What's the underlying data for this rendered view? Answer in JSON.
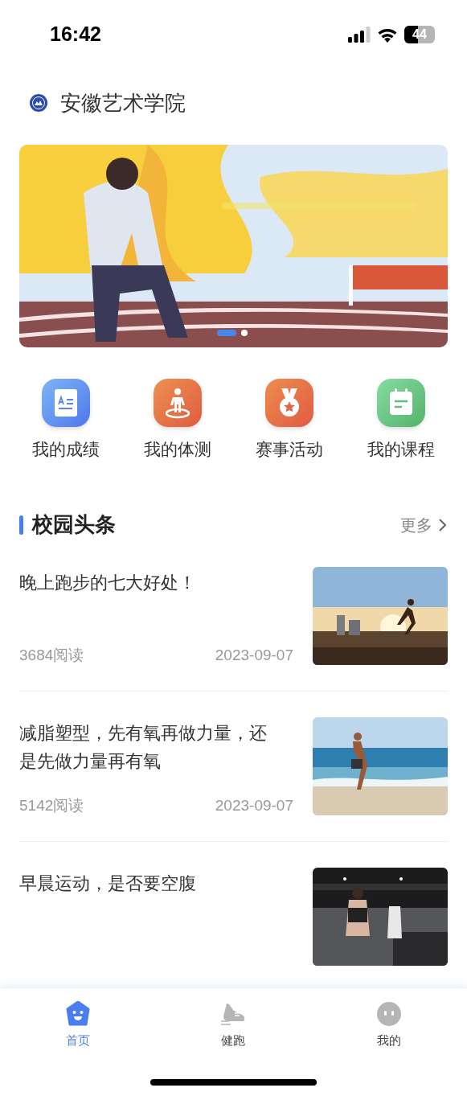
{
  "status_bar": {
    "time": "16:42",
    "battery": "44"
  },
  "header": {
    "title": "安徽艺术学院"
  },
  "banner": {
    "dots": [
      {
        "selected": true
      },
      {
        "selected": false
      }
    ]
  },
  "shortcuts": [
    {
      "label": "我的成绩",
      "kind": "grades"
    },
    {
      "label": "我的体测",
      "kind": "fitness"
    },
    {
      "label": "赛事活动",
      "kind": "events"
    },
    {
      "label": "我的课程",
      "kind": "courses"
    }
  ],
  "section": {
    "title": "校园头条",
    "more": "更多"
  },
  "articles": [
    {
      "title": "晚上跑步的七大好处！",
      "reads": "3684阅读",
      "date": "2023-09-07"
    },
    {
      "title": "减脂塑型，先有氧再做力量，还是先做力量再有氧",
      "reads": "5142阅读",
      "date": "2023-09-07"
    },
    {
      "title": "早晨运动，是否要空腹"
    }
  ],
  "tab_bar": [
    {
      "label": "首页",
      "kind": "home",
      "selected": true
    },
    {
      "label": "健跑",
      "kind": "run",
      "selected": false
    },
    {
      "label": "我的",
      "kind": "me",
      "selected": false
    }
  ]
}
